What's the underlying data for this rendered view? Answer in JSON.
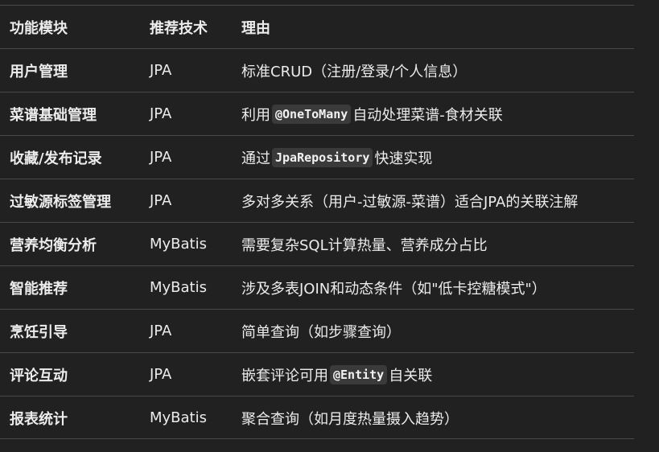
{
  "table": {
    "headers": [
      "功能模块",
      "推荐技术",
      "理由"
    ],
    "rows": [
      {
        "module": "用户管理",
        "tech": "JPA",
        "reason_pre": "标准CRUD（注册/登录/个人信息）"
      },
      {
        "module": "菜谱基础管理",
        "tech": "JPA",
        "reason_pre": "利用",
        "reason_code": "@OneToMany",
        "reason_post": "自动处理菜谱-食材关联"
      },
      {
        "module": "收藏/发布记录",
        "tech": "JPA",
        "reason_pre": "通过",
        "reason_code": "JpaRepository",
        "reason_post": "快速实现"
      },
      {
        "module": "过敏源标签管理",
        "tech": "JPA",
        "reason_pre": "多对多关系（用户-过敏源-菜谱）适合JPA的关联注解"
      },
      {
        "module": "营养均衡分析",
        "tech": "MyBatis",
        "reason_pre": "需要复杂SQL计算热量、营养成分占比"
      },
      {
        "module": "智能推荐",
        "tech": "MyBatis",
        "reason_pre": "涉及多表JOIN和动态条件（如\"低卡控糖模式\"）"
      },
      {
        "module": "烹饪引导",
        "tech": "JPA",
        "reason_pre": "简单查询（如步骤查询）"
      },
      {
        "module": "评论互动",
        "tech": "JPA",
        "reason_pre": "嵌套评论可用",
        "reason_code": "@Entity",
        "reason_post": "自关联"
      },
      {
        "module": "报表统计",
        "tech": "MyBatis",
        "reason_pre": "聚合查询（如月度热量摄入趋势）"
      }
    ]
  }
}
